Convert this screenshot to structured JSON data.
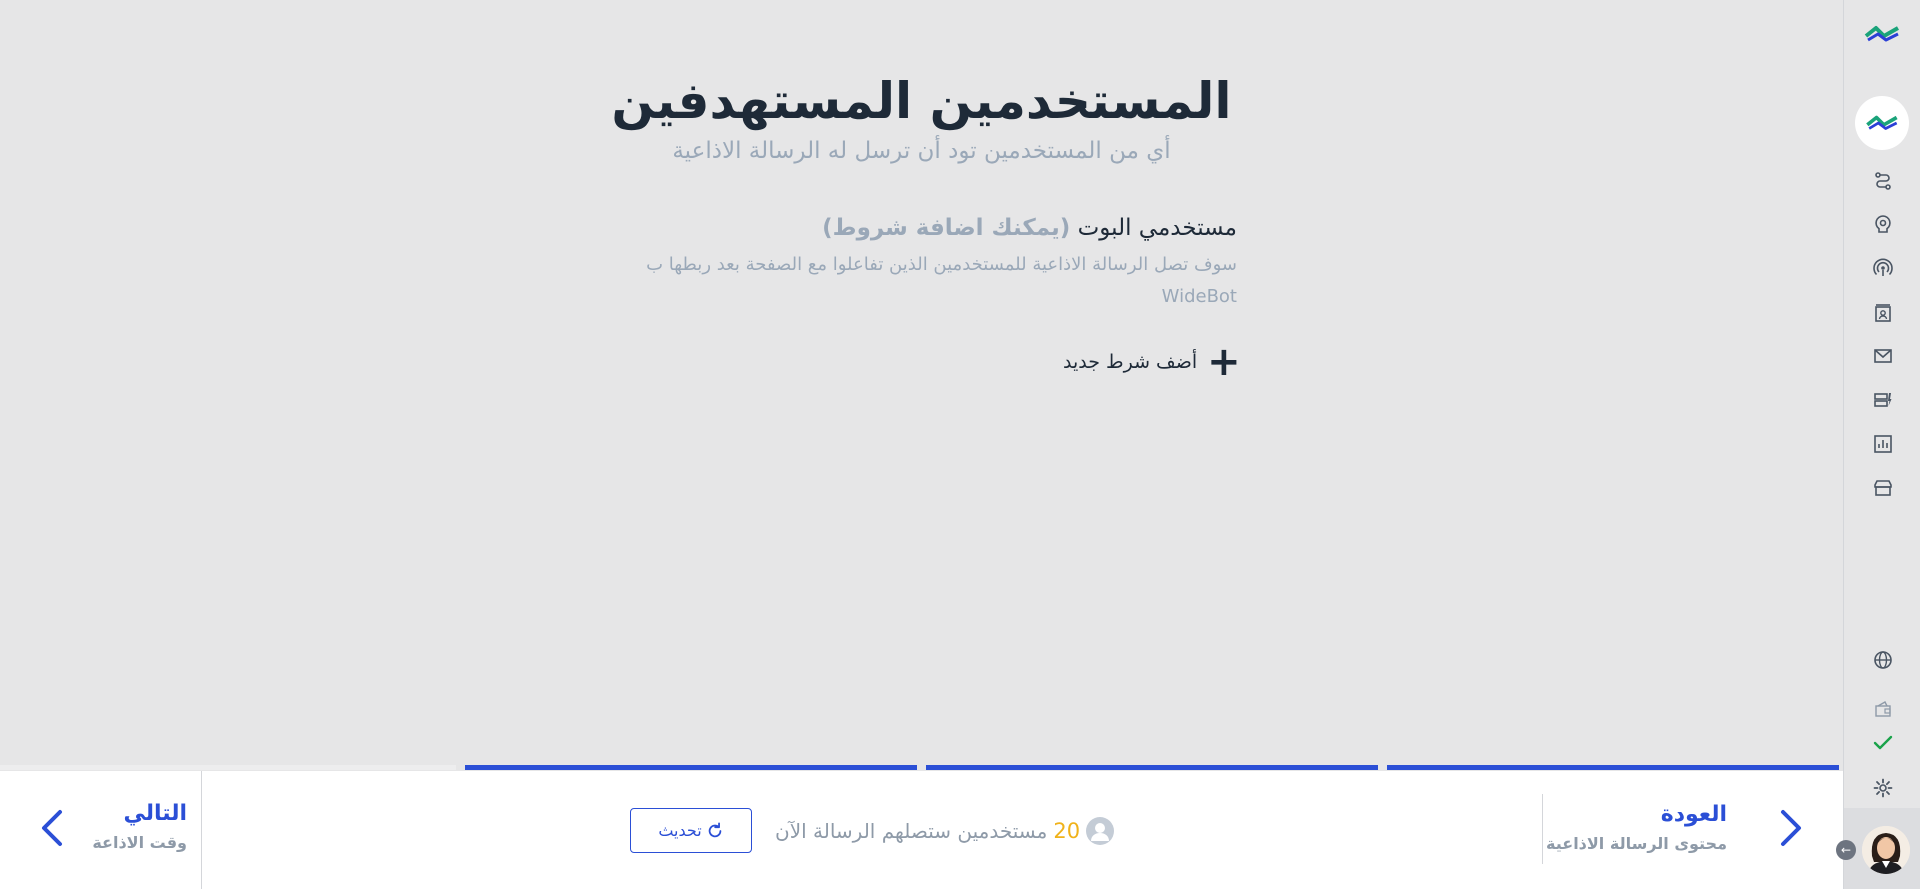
{
  "header": {
    "title": "المستخدمين المستهدفين",
    "subtitle": "أي من المستخدمين تود أن ترسل له الرسالة الاذاعية"
  },
  "section": {
    "heading": "مستخدمي البوت",
    "hint": "(يمكنك اضافة شروط)",
    "description": "سوف تصل الرسالة الاذاعية للمستخدمين الذين تفاعلوا مع الصفحة بعد ربطها ب WideBot",
    "add_condition_label": "أضف شرط جديد"
  },
  "progress": {
    "steps_total": 4,
    "steps_completed": 3,
    "active_color": "#2b4fd6",
    "inactive_color": "#ededee"
  },
  "footer": {
    "back_label": "العودة",
    "back_sublabel": "محتوى الرسالة الاذاعية",
    "next_label": "التالي",
    "next_sublabel": "وقت الاذاعة",
    "users_count": "20",
    "users_label": "مستخدمين ستصلهم الرسالة الآن",
    "refresh_label": "تحديث"
  },
  "sidebar": {
    "icons": [
      "logo-icon",
      "bot-avatar",
      "flows-icon",
      "brain-icon",
      "broadcast-icon",
      "contacts-icon",
      "mail-icon",
      "templates-icon",
      "analytics-icon",
      "store-icon",
      "globe-icon",
      "wallet-icon",
      "check-icon",
      "settings-icon",
      "user-avatar"
    ]
  },
  "colors": {
    "accent": "#2b4fd6",
    "count": "#f0b21a",
    "muted": "#9aa8b8",
    "text": "#1e2a38",
    "check": "#1aa34a"
  }
}
